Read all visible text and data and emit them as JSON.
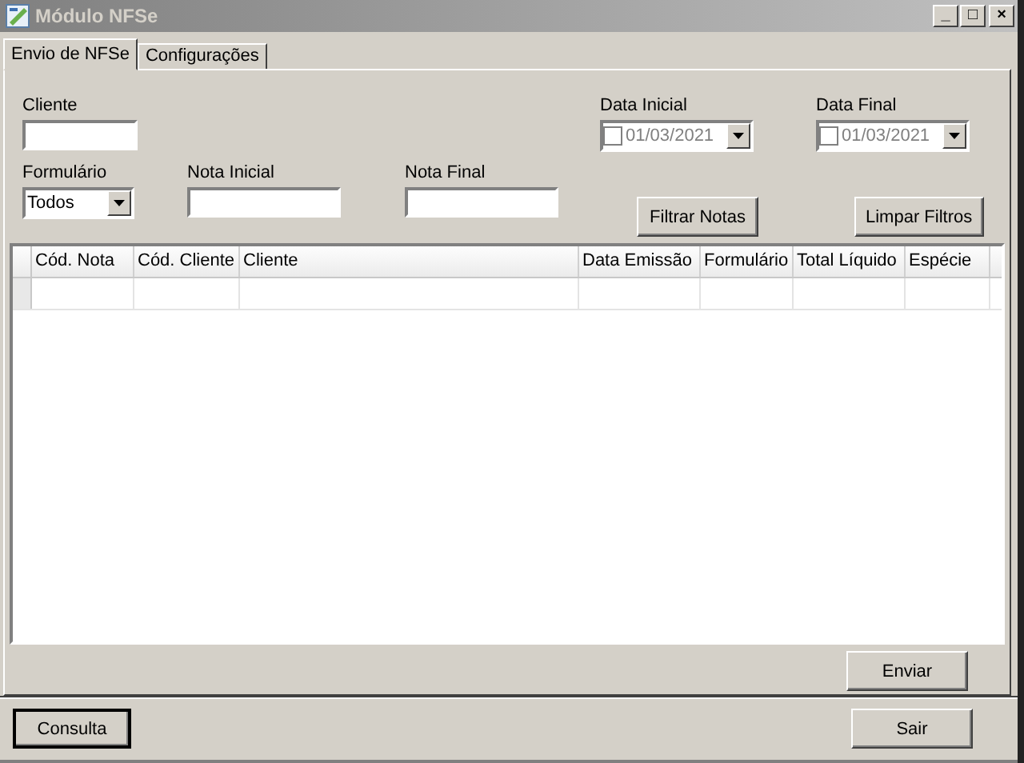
{
  "window": {
    "title": "Módulo NFSe",
    "controls": [
      "_",
      "□",
      "×"
    ]
  },
  "tabs": [
    {
      "label": "Envio de NFSe",
      "selected": true
    },
    {
      "label": "Configurações",
      "selected": false
    }
  ],
  "filters": {
    "cliente": {
      "label": "Cliente"
    },
    "formulario": {
      "label": "Formulário",
      "value": "Todos"
    },
    "nota_inicial": {
      "label": "Nota Inicial"
    },
    "nota_final": {
      "label": "Nota Final"
    },
    "dates": [
      {
        "label": "Data Inicial",
        "value": "01/03/2021",
        "checked": false
      },
      {
        "label": "Data Final",
        "value": "01/03/2021",
        "checked": false
      }
    ],
    "buttons": [
      "Filtrar Notas",
      "Limpar Filtros"
    ]
  },
  "table": {
    "columns": [
      "Cód. Nota",
      "Cód. Cliente",
      "Cliente",
      "Data Emissão",
      "Formulário",
      "Total Líquido",
      "Espécie"
    ]
  },
  "send_button": "Enviar",
  "footer_buttons": [
    {
      "label": "Consulta",
      "default": true
    },
    {
      "label": "Sair",
      "default": false
    }
  ]
}
